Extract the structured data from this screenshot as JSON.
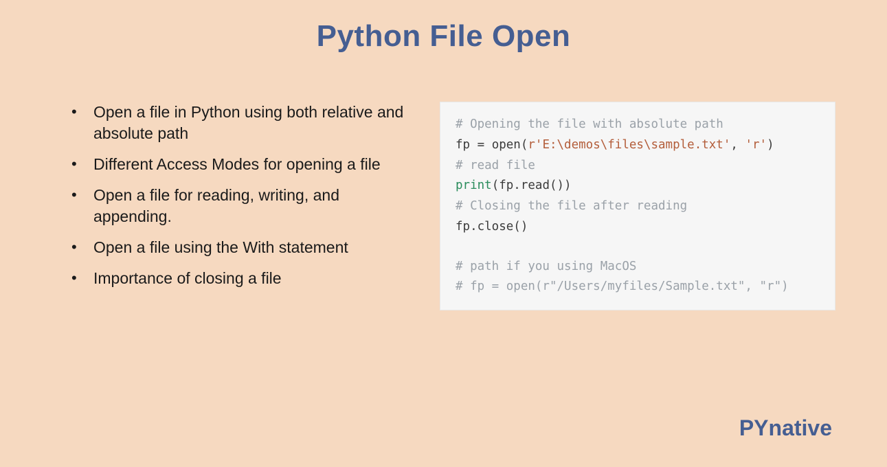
{
  "title": "Python File Open",
  "bullets": [
    "Open a file in Python using both relative and absolute path",
    "Different Access Modes for opening a file",
    "Open a file for reading, writing, and appending.",
    "Open a file using the With statement",
    "Importance of closing a file"
  ],
  "code": {
    "c1": "# Opening the file with absolute path",
    "l2a": "fp ",
    "l2b": "=",
    "l2c": " open(",
    "l2d": "r'E:\\demos\\files\\sample.txt'",
    "l2e": ", ",
    "l2f": "'r'",
    "l2g": ")",
    "c3": "# read file",
    "l4a": "print",
    "l4b": "(fp.read())",
    "c5": "# Closing the file after reading",
    "l6": "fp.close()",
    "c7": "# path if you using MacOS",
    "c8": "# fp = open(r\"/Users/myfiles/Sample.txt\", \"r\")"
  },
  "footer": "PYnative"
}
